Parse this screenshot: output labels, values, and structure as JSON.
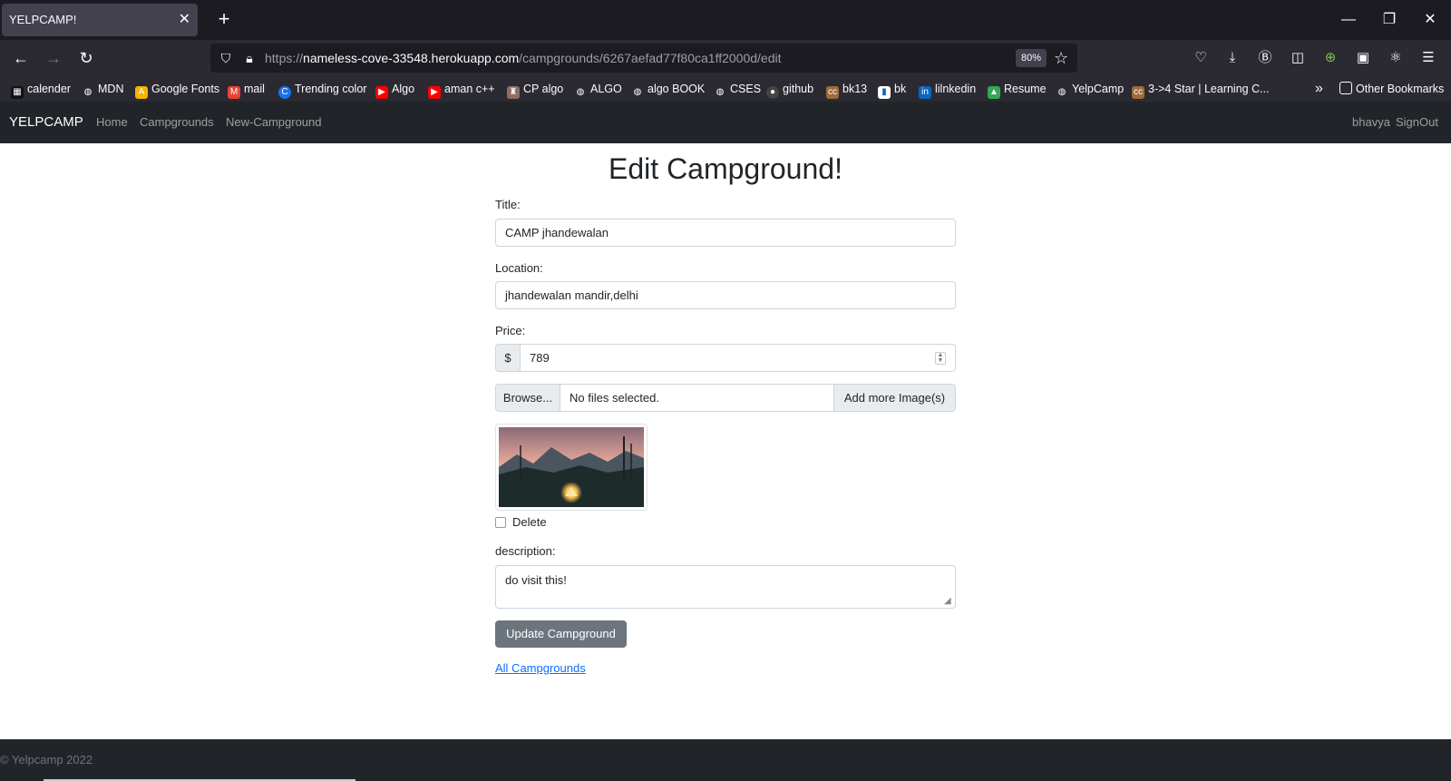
{
  "browser": {
    "tab_title": "YELPCAMP!",
    "url_scheme": "https://",
    "url_host": "nameless-cove-33548.herokuapp.com",
    "url_path": "/campgrounds/6267aefad77f80ca1ff2000d/edit",
    "zoom": "80%",
    "bookmarks": [
      {
        "label": "calender",
        "color": "#111111"
      },
      {
        "label": "MDN",
        "color": "#555555"
      },
      {
        "label": "Google Fonts",
        "color": "#f4b400"
      },
      {
        "label": "mail",
        "color": "#ea4335"
      },
      {
        "label": "Trending color",
        "color": "#1a73e8"
      },
      {
        "label": "Algo",
        "color": "#ff0000"
      },
      {
        "label": "aman c++",
        "color": "#ff0000"
      },
      {
        "label": "CP algo",
        "color": "#8d6e63"
      },
      {
        "label": "ALGO",
        "color": "#555555"
      },
      {
        "label": "algo BOOK",
        "color": "#555555"
      },
      {
        "label": "CSES",
        "color": "#555555"
      },
      {
        "label": "github",
        "color": "#444444"
      },
      {
        "label": "bk13",
        "color": "#9e6b3a"
      },
      {
        "label": "bk",
        "color": "#1565c0"
      },
      {
        "label": "lilnkedin",
        "color": "#0a66c2"
      },
      {
        "label": "Resume",
        "color": "#34a853"
      },
      {
        "label": "YelpCamp",
        "color": "#555555"
      },
      {
        "label": "3->4 Star | Learning C...",
        "color": "#9e6b3a"
      }
    ],
    "other_bookmarks": "Other Bookmarks"
  },
  "appnav": {
    "brand": "YELPCAMP",
    "links": [
      "Home",
      "Campgrounds",
      "New-Campground"
    ],
    "user": "bhavya",
    "signout": "SignOut"
  },
  "form": {
    "heading": "Edit Campground!",
    "title_label": "Title:",
    "title_value": "CAMP jhandewalan",
    "location_label": "Location:",
    "location_value": "jhandewalan mandir,delhi",
    "price_label": "Price:",
    "currency": "$",
    "price_value": "789",
    "browse_label": "Browse...",
    "file_status": "No files selected.",
    "add_images_label": "Add more Image(s)",
    "delete_label": "Delete",
    "description_label": "description:",
    "description_value": "do visit this!",
    "submit_label": "Update Campground",
    "back_link": "All Campgrounds"
  },
  "footer": {
    "text": "© Yelpcamp 2022"
  }
}
